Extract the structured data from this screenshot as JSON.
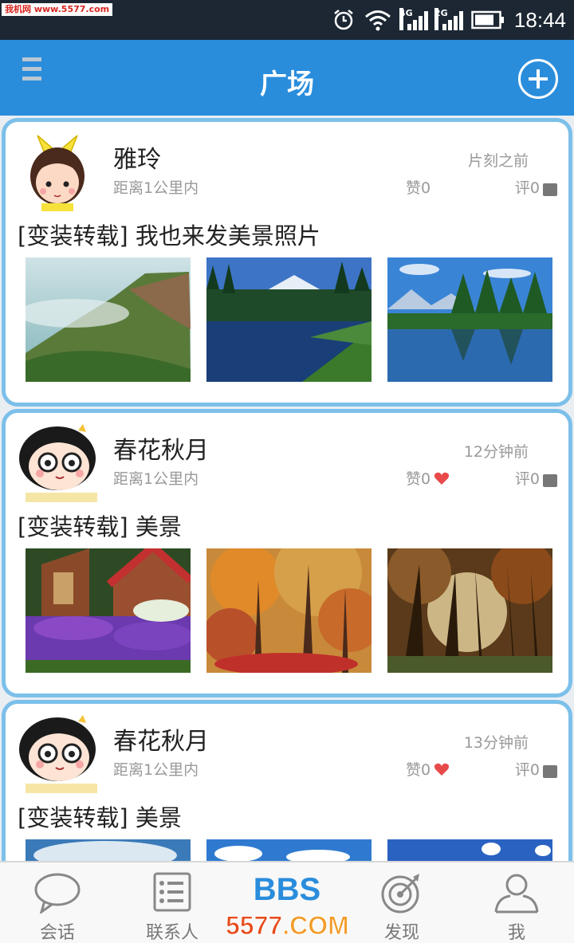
{
  "status_bar": {
    "watermark": "我机网 www.5577.com",
    "network_1": "4G",
    "network_2": "2G",
    "time": "18:44"
  },
  "header": {
    "title": "广场"
  },
  "posts": [
    {
      "author": "雅玲",
      "time": "片刻之前",
      "distance": "距离1公里内",
      "likes": "赞0",
      "liked": false,
      "comments": "评0",
      "title": "[变装转载] 我也来发美景照片",
      "photos": [
        "misty-cliff",
        "mountain-lake",
        "alpine-lake"
      ]
    },
    {
      "author": "春花秋月",
      "time": "12分钟前",
      "distance": "距离1公里内",
      "likes": "赞0",
      "liked": true,
      "comments": "评0",
      "title": "[变装转载] 美景",
      "photos": [
        "lavender-cottage",
        "autumn-forest",
        "sunlit-trees"
      ]
    },
    {
      "author": "春花秋月",
      "time": "13分钟前",
      "distance": "距离1公里内",
      "likes": "赞0",
      "liked": true,
      "comments": "评0",
      "title": "[变装转载] 美景",
      "photos": [
        "sky-clouds",
        "sky-clouds",
        "sky-blue"
      ]
    }
  ],
  "tabs": [
    {
      "label": "会话",
      "icon": "chat-bubble-icon"
    },
    {
      "label": "联系人",
      "icon": "contacts-list-icon"
    },
    {
      "label": "",
      "icon": "bbs-icon",
      "icon_text": "BBS"
    },
    {
      "label": "发现",
      "icon": "discover-icon"
    },
    {
      "label": "我",
      "icon": "profile-icon"
    }
  ],
  "watermark": {
    "main": "5577",
    "suffix": ".COM"
  },
  "colors": {
    "accent": "#2a8ddc",
    "card_border": "#7cc0ea",
    "status_bar": "#1c2733",
    "heart": "#e84a4a"
  }
}
